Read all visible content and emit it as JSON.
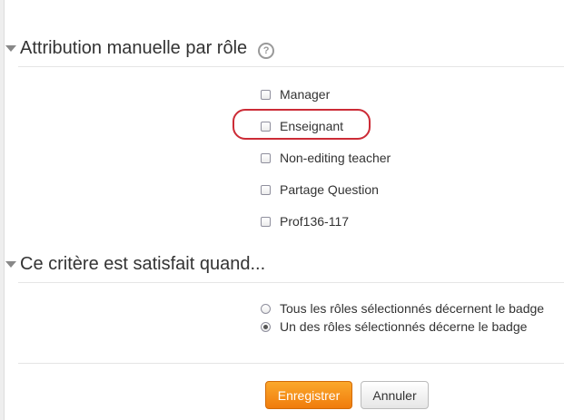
{
  "section_roles": {
    "legend": "Attribution manuelle par rôle",
    "help_icon_glyph": "?",
    "roles": [
      {
        "label": "Manager",
        "checked": false
      },
      {
        "label": "Enseignant",
        "checked": false,
        "highlighted": true
      },
      {
        "label": "Non-editing teacher",
        "checked": false
      },
      {
        "label": "Partage Question",
        "checked": false
      },
      {
        "label": "Prof136-117",
        "checked": false
      }
    ]
  },
  "section_criteria": {
    "legend": "Ce critère est satisfait quand...",
    "options": [
      {
        "label": "Tous les rôles sélectionnés décernent le badge",
        "selected": false
      },
      {
        "label": "Un des rôles sélectionnés décerne le badge",
        "selected": true
      }
    ]
  },
  "actions": {
    "save_label": "Enregistrer",
    "cancel_label": "Annuler"
  },
  "colors": {
    "primary_button": "#f28a12",
    "highlight_ring": "#cc2b36"
  }
}
